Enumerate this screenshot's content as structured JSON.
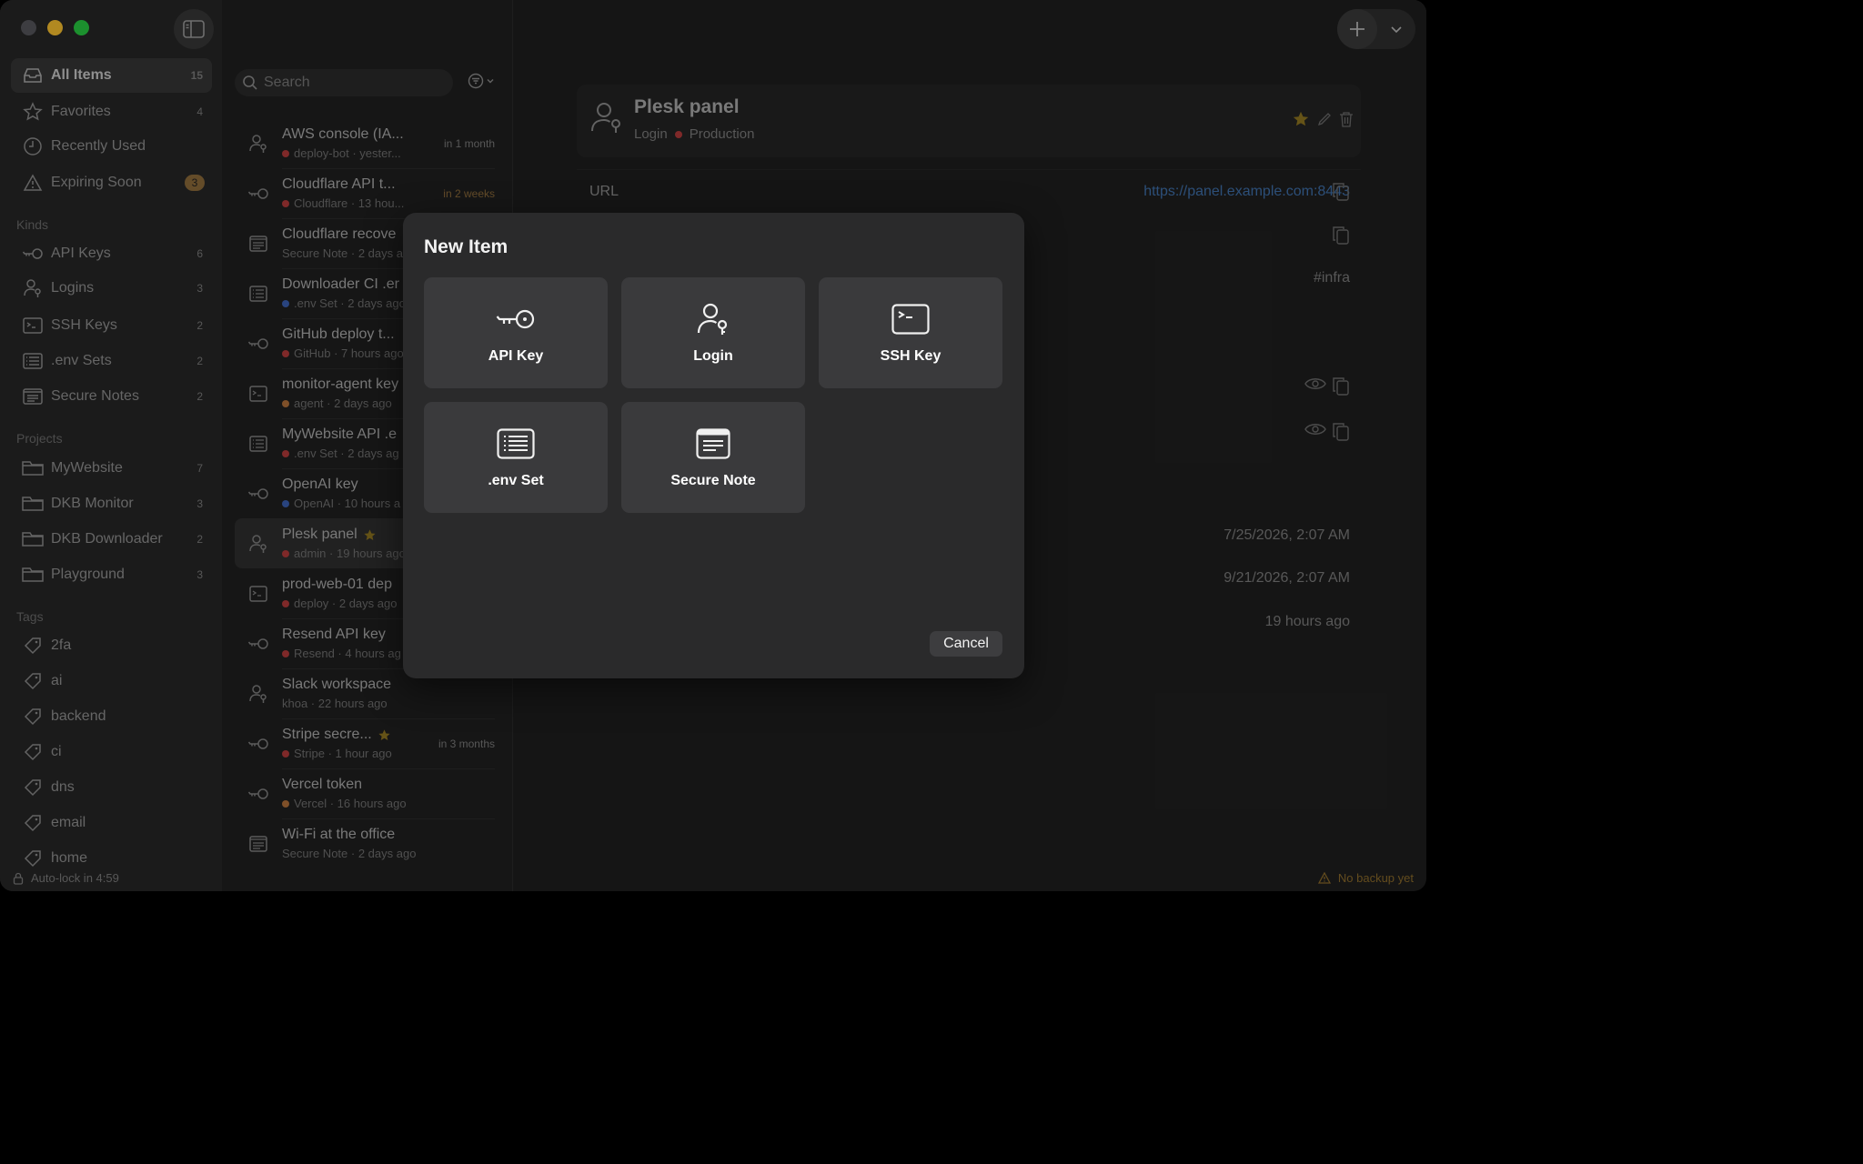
{
  "sidebar": {
    "all_items": {
      "label": "All Items",
      "count": "15"
    },
    "favorites": {
      "label": "Favorites",
      "count": "4"
    },
    "recently_used": {
      "label": "Recently Used"
    },
    "expiring_soon": {
      "label": "Expiring Soon",
      "count": "3"
    },
    "kinds_title": "Kinds",
    "kinds": [
      {
        "label": "API Keys",
        "count": "6"
      },
      {
        "label": "Logins",
        "count": "3"
      },
      {
        "label": "SSH Keys",
        "count": "2"
      },
      {
        "label": ".env Sets",
        "count": "2"
      },
      {
        "label": "Secure Notes",
        "count": "2"
      }
    ],
    "projects_title": "Projects",
    "projects": [
      {
        "label": "MyWebsite",
        "count": "7"
      },
      {
        "label": "DKB Monitor",
        "count": "3"
      },
      {
        "label": "DKB Downloader",
        "count": "2"
      },
      {
        "label": "Playground",
        "count": "3"
      }
    ],
    "tags_title": "Tags",
    "tags": [
      "2fa",
      "ai",
      "backend",
      "ci",
      "dns",
      "email",
      "home"
    ]
  },
  "status": {
    "autolock": "Auto-lock in 4:59",
    "backup": "No backup yet"
  },
  "search": {
    "placeholder": "Search"
  },
  "items": [
    {
      "title": "AWS console (IA...",
      "sub": "deploy-bot · yester...",
      "dot": "#b03a3a",
      "exp": "in 1 month"
    },
    {
      "title": "Cloudflare API t...",
      "sub": "Cloudflare · 13 hou...",
      "dot": "#b03a3a",
      "exp": "in 2 weeks"
    },
    {
      "title": "Cloudflare recove",
      "sub": "Secure Note · 2 days a",
      "dot": "",
      "exp": ""
    },
    {
      "title": "Downloader CI .er",
      "sub": ".env Set · 2 days ago",
      "dot": "#3a5fb0",
      "exp": ""
    },
    {
      "title": "GitHub deploy t...",
      "sub": "GitHub · 7 hours ago",
      "dot": "#b03a3a",
      "exp": ""
    },
    {
      "title": "monitor-agent key",
      "sub": "agent · 2 days ago",
      "dot": "#b0703a",
      "exp": ""
    },
    {
      "title": "MyWebsite API .e",
      "sub": ".env Set · 2 days ag",
      "dot": "#b03a3a",
      "exp": ""
    },
    {
      "title": "OpenAI key",
      "sub": "OpenAI · 10 hours a",
      "dot": "#3a5fb0",
      "exp": ""
    },
    {
      "title": "Plesk panel",
      "sub": "admin · 19 hours ago",
      "dot": "#b03a3a",
      "exp": ""
    },
    {
      "title": "prod-web-01 dep",
      "sub": "deploy · 2 days ago",
      "dot": "#b03a3a",
      "exp": ""
    },
    {
      "title": "Resend API key",
      "sub": "Resend · 4 hours ag",
      "dot": "#b03a3a",
      "exp": ""
    },
    {
      "title": "Slack workspace",
      "sub": "khoa · 22 hours ago",
      "dot": "",
      "exp": ""
    },
    {
      "title": "Stripe secre...",
      "sub": "Stripe · 1 hour ago",
      "dot": "#b03a3a",
      "exp": "in 3 months"
    },
    {
      "title": "Vercel token",
      "sub": "Vercel · 16 hours ago",
      "dot": "#b0703a",
      "exp": ""
    },
    {
      "title": "Wi-Fi at the office",
      "sub": "Secure Note · 2 days ago",
      "dot": "",
      "exp": ""
    }
  ],
  "detail": {
    "title": "Plesk panel",
    "kind": "Login",
    "project": "Production",
    "url_label": "URL",
    "url_value": "https://panel.example.com:8443",
    "tag": "#infra",
    "date1": "7/25/2026, 2:07 AM",
    "date2": "9/21/2026, 2:07 AM",
    "date3": "19 hours ago"
  },
  "modal": {
    "title": "New Item",
    "options": [
      "API Key",
      "Login",
      "SSH Key",
      ".env Set",
      "Secure Note"
    ],
    "cancel": "Cancel"
  },
  "colors": {
    "accent_star": "#c9a227",
    "warning": "#8b6a3a",
    "link": "#3e6ea8",
    "dot_red": "#b03a3a"
  }
}
